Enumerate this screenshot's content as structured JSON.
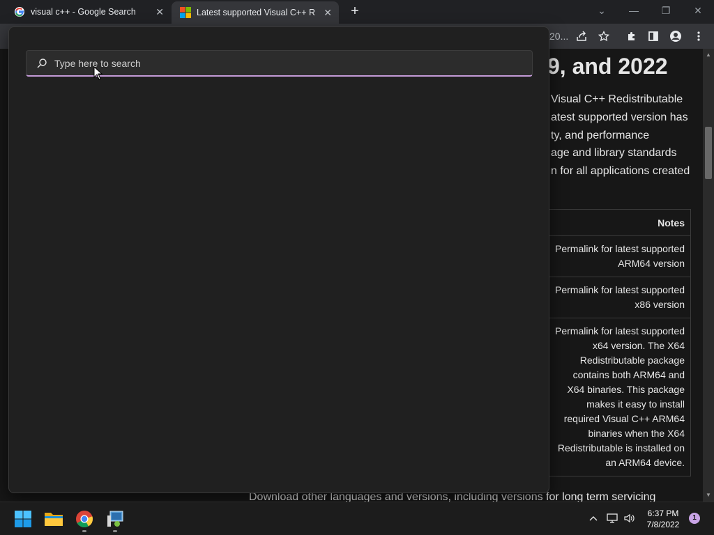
{
  "browser": {
    "tabs": [
      {
        "title": "visual c++ - Google Search",
        "icon": "google-icon",
        "close": "✕"
      },
      {
        "title": "Latest supported Visual C++ Redistributable",
        "icon": "microsoft-icon",
        "close": "✕"
      }
    ],
    "new_tab": "+",
    "window_controls": {
      "dropdown": "⌄",
      "minimize": "—",
      "restore": "❐",
      "close": "✕"
    },
    "address_fragment": "20..."
  },
  "page": {
    "heading_fragment": "9, and 2022",
    "paragraph_lines": [
      "Visual C++ Redistributable",
      "atest supported version has",
      "ty, and performance",
      "age and library standards",
      "n for all applications created"
    ],
    "table": {
      "header": "Notes",
      "rows": [
        "Permalink for latest supported ARM64 version",
        "Permalink for latest supported x86 version",
        "Permalink for latest supported x64 version. The X64 Redistributable package contains both ARM64 and X64 binaries. This package makes it easy to install required Visual C++ ARM64 binaries when the X64 Redistributable is installed on an ARM64 device."
      ]
    },
    "footer_text": "Download other languages and versions, including versions for long term servicing"
  },
  "search": {
    "placeholder": "Type here to search",
    "value": ""
  },
  "taskbar": {
    "apps": [
      "windows-start-icon",
      "file-explorer-icon",
      "chrome-icon",
      "control-panel-icon"
    ],
    "tray": {
      "chevron": "^",
      "time": "6:37 PM",
      "date": "7/8/2022",
      "notifications": "1"
    }
  },
  "colors": {
    "search_accent": "#c49bd8",
    "notification_badge": "#c9a4e6"
  }
}
